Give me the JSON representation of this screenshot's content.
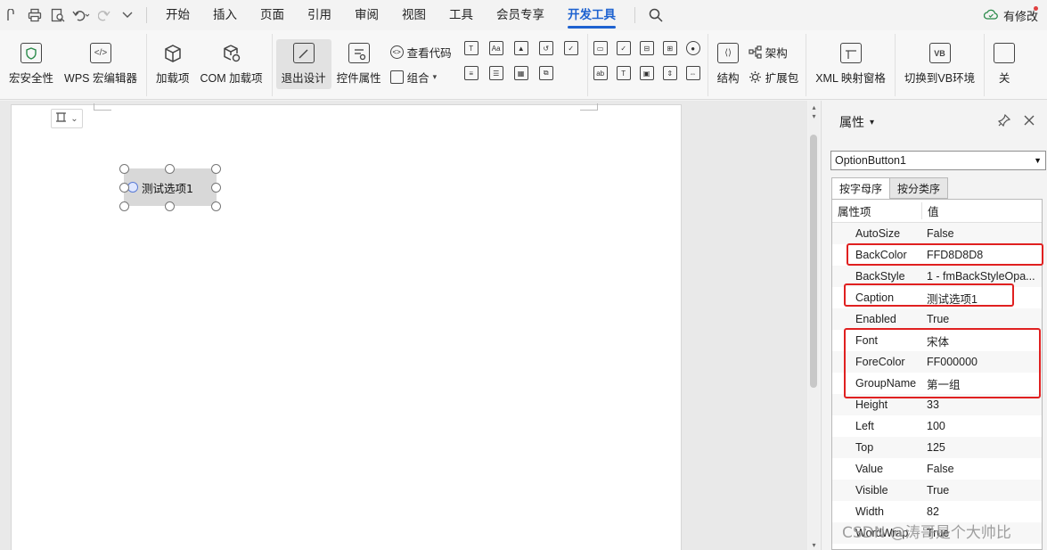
{
  "menubar": {
    "tabs": [
      {
        "label": "开始"
      },
      {
        "label": "插入"
      },
      {
        "label": "页面"
      },
      {
        "label": "引用"
      },
      {
        "label": "审阅"
      },
      {
        "label": "视图"
      },
      {
        "label": "工具"
      },
      {
        "label": "会员专享"
      },
      {
        "label": "开发工具"
      }
    ],
    "active_tab": "开发工具",
    "modify_label": "有修改"
  },
  "ribbon": {
    "macro_security": "宏安全性",
    "wps_macro_editor": "WPS 宏编辑器",
    "addins": "加载项",
    "com_addins": "COM 加载项",
    "exit_design": "退出设计",
    "control_properties": "控件属性",
    "view_code": "查看代码",
    "group": "组合",
    "structure": "结构",
    "schema": "架构",
    "expansion_pack": "扩展包",
    "xml_mapping_pane": "XML 映射窗格",
    "switch_vb": "切换到VB环境",
    "close_partial": "关"
  },
  "document": {
    "option_caption": "测试选项1"
  },
  "panel": {
    "title": "属性",
    "object_selector": "OptionButton1",
    "tab_alphabetic": "按字母序",
    "tab_categorized": "按分类序",
    "col_property": "属性项",
    "col_value": "值",
    "rows": [
      {
        "name": "AutoSize",
        "value": "False"
      },
      {
        "name": "BackColor",
        "value": "FFD8D8D8"
      },
      {
        "name": "BackStyle",
        "value": "1 - fmBackStyleOpa..."
      },
      {
        "name": "Caption",
        "value": "测试选项1"
      },
      {
        "name": "Enabled",
        "value": "True"
      },
      {
        "name": "Font",
        "value": "宋体"
      },
      {
        "name": "ForeColor",
        "value": "FF000000"
      },
      {
        "name": "GroupName",
        "value": "第一组"
      },
      {
        "name": "Height",
        "value": "33"
      },
      {
        "name": "Left",
        "value": "100"
      },
      {
        "name": "Top",
        "value": "125"
      },
      {
        "name": "Value",
        "value": "False"
      },
      {
        "name": "Visible",
        "value": "True"
      },
      {
        "name": "Width",
        "value": "82"
      },
      {
        "name": "WordWrap",
        "value": "True"
      }
    ]
  },
  "watermark": "CSDN @涛哥是个大帅比",
  "colors": {
    "accent": "#1e62d0",
    "highlight": "#e02020",
    "control_back": "#d8d8d8"
  }
}
